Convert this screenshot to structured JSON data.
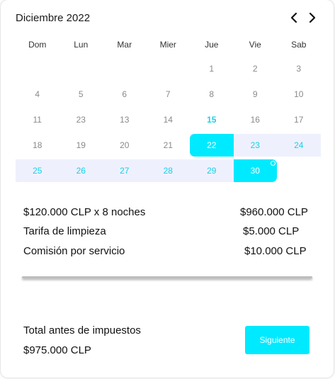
{
  "calendar": {
    "month_title": "Diciembre 2022",
    "prev_icon": "chevron-left-icon",
    "next_icon": "chevron-right-icon",
    "weekdays": [
      "Dom",
      "Lun",
      "Mar",
      "Mier",
      "Jue",
      "Vie",
      "Sab"
    ],
    "weeks": [
      [
        "",
        "",
        "",
        "",
        "1",
        "2",
        "3"
      ],
      [
        "4",
        "5",
        "6",
        "7",
        "8",
        "9",
        "10"
      ],
      [
        "11",
        "23",
        "13",
        "14",
        "15",
        "16",
        "17"
      ],
      [
        "18",
        "19",
        "20",
        "21",
        "22",
        "23",
        "24"
      ],
      [
        "25",
        "26",
        "27",
        "28",
        "29",
        "30",
        ""
      ]
    ],
    "today": "15",
    "selection_start": "22",
    "selection_end": "30",
    "colors": {
      "accent": "#00eaff",
      "range_band": "#eef1fd",
      "range_text": "#17d1e9"
    }
  },
  "pricing": {
    "nightly_label": "$120.000 CLP x 8 noches",
    "nightly_amount": "$960.000 CLP",
    "cleaning_label": "Tarifa de limpieza",
    "cleaning_amount": "$5.000 CLP",
    "service_label": "Comisión por servicio",
    "service_amount": "$10.000 CLP"
  },
  "summary": {
    "total_label": "Total antes de impuestos",
    "total_amount": "$975.000 CLP",
    "next_button": "Siguiente"
  }
}
